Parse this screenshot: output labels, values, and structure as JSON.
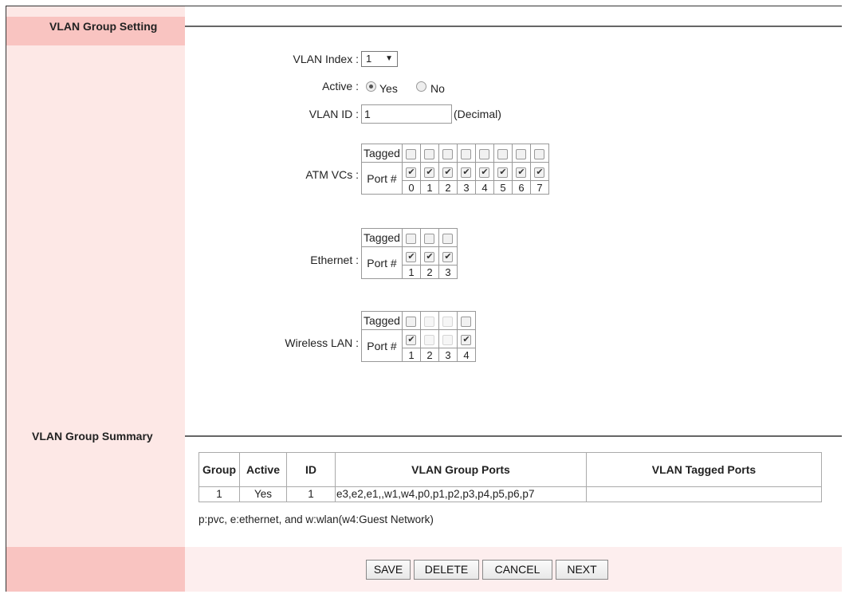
{
  "setting": {
    "title": "VLAN Group Setting",
    "vlan_index_label": "VLAN Index :",
    "vlan_index_value": "1",
    "vlan_index_arrow": "▼",
    "active_label": "Active :",
    "yes_label": "Yes",
    "no_label": "No",
    "active_selected": "Yes",
    "vlan_id_label": "VLAN ID :",
    "vlan_id_value": "1",
    "vlan_id_hint": "(Decimal)",
    "tagged_label": "Tagged",
    "port_label": "Port #",
    "atm": {
      "label": "ATM VCs :",
      "ports": [
        "0",
        "1",
        "2",
        "3",
        "4",
        "5",
        "6",
        "7"
      ],
      "tagged": [
        false,
        false,
        false,
        false,
        false,
        false,
        false,
        false
      ],
      "member": [
        true,
        true,
        true,
        true,
        true,
        true,
        true,
        true
      ],
      "disabled": [
        false,
        false,
        false,
        false,
        false,
        false,
        false,
        false
      ]
    },
    "ethernet": {
      "label": "Ethernet :",
      "ports": [
        "1",
        "2",
        "3"
      ],
      "tagged": [
        false,
        false,
        false
      ],
      "member": [
        true,
        true,
        true
      ],
      "disabled": [
        false,
        false,
        false
      ]
    },
    "wlan": {
      "label": "Wireless LAN :",
      "ports": [
        "1",
        "2",
        "3",
        "4"
      ],
      "tagged": [
        false,
        false,
        false,
        false
      ],
      "member": [
        true,
        false,
        false,
        true
      ],
      "disabled": [
        false,
        true,
        true,
        false
      ]
    }
  },
  "summary": {
    "title": "VLAN Group Summary",
    "columns": [
      "Group",
      "Active",
      "ID",
      "VLAN Group Ports",
      "VLAN Tagged Ports"
    ],
    "rows": [
      [
        "1",
        "Yes",
        "1",
        "e3,e2,e1,,w1,w4,p0,p1,p2,p3,p4,p5,p6,p7",
        ""
      ]
    ],
    "note": "p:pvc, e:ethernet, and w:wlan(w4:Guest Network)"
  },
  "buttons": {
    "save": "SAVE",
    "delete": "DELETE",
    "cancel": "CANCEL",
    "next": "NEXT"
  }
}
